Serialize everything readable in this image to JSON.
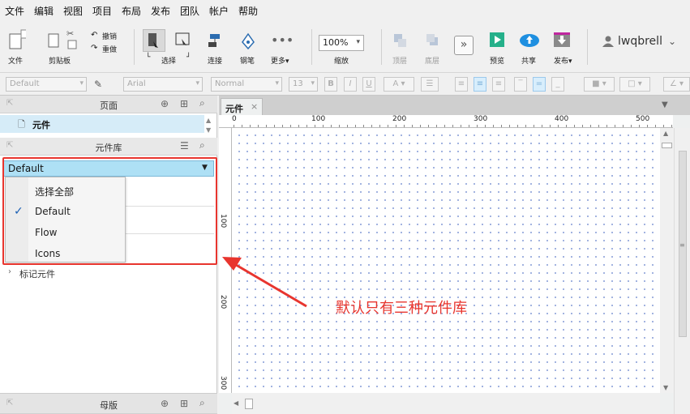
{
  "menu": [
    "文件",
    "编辑",
    "视图",
    "项目",
    "布局",
    "发布",
    "团队",
    "帐户",
    "帮助"
  ],
  "toolbar": {
    "file_label": "文件",
    "clipboard_label": "剪贴板",
    "undo_label": "撤销",
    "redo_label": "重做",
    "select_label": "选择",
    "connect_label": "连接",
    "pen_label": "钢笔",
    "more_label": "更多▾",
    "zoom_value": "100%",
    "zoom_label": "缩放",
    "top_label": "顶层",
    "bottom_label": "底层",
    "preview_label": "预览",
    "share_label": "共享",
    "publish_label": "发布▾",
    "user_name": "lwqbrell"
  },
  "format": {
    "style_value": "Default",
    "font_value": "Arial",
    "weight_value": "Normal",
    "size_value": "13"
  },
  "pages_panel": {
    "title": "页面",
    "page_name": "元件"
  },
  "library_panel": {
    "title": "元件库",
    "selected": "Default",
    "options": [
      "选择全部",
      "Default",
      "Flow",
      "Icons"
    ],
    "checkmark": "✓",
    "tagged_label": "标记元件"
  },
  "masters_panel": {
    "title": "母版"
  },
  "canvas": {
    "tab_label": "元件",
    "tab_close": "×",
    "ruler_h": [
      "0",
      "100",
      "200",
      "300",
      "400",
      "500"
    ],
    "ruler_v": [
      "100",
      "200",
      "300"
    ]
  },
  "annotation": {
    "text": "默认只有三种元件库",
    "color": "#e8352e"
  }
}
